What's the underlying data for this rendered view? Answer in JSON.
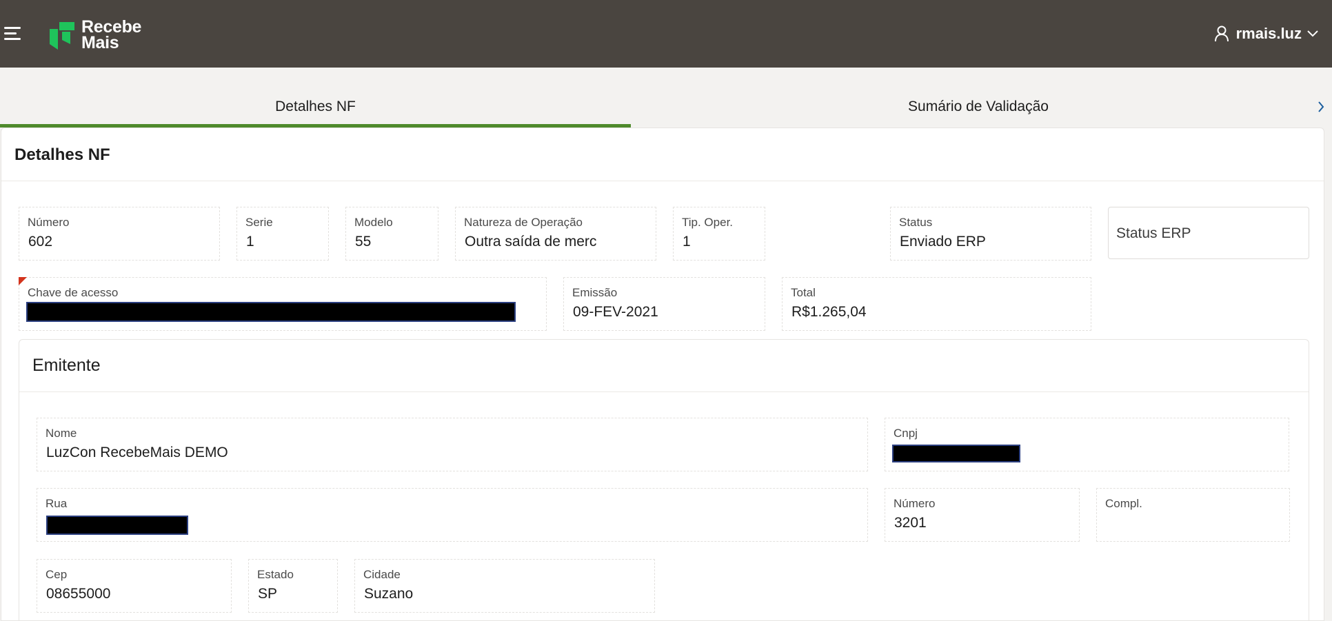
{
  "header": {
    "logo_line1": "Recebe",
    "logo_line2": "Mais",
    "brand_color": "#1fc35b",
    "username": "rmais.luz"
  },
  "tabs": [
    {
      "label": "Detalhes NF",
      "active": true
    },
    {
      "label": "Sumário de Validação",
      "active": false
    }
  ],
  "nf": {
    "title": "Detalhes NF",
    "numero": {
      "label": "Número",
      "value": "602"
    },
    "serie": {
      "label": "Serie",
      "value": "1"
    },
    "modelo": {
      "label": "Modelo",
      "value": "55"
    },
    "natureza": {
      "label": "Natureza de Operação",
      "value": "Outra saída de merc"
    },
    "tip_oper": {
      "label": "Tip. Oper.",
      "value": "1"
    },
    "status": {
      "label": "Status",
      "value": "Enviado ERP"
    },
    "status_erp": {
      "label": "Status ERP"
    },
    "chave": {
      "label": "Chave de acesso"
    },
    "emissao": {
      "label": "Emissão",
      "value": "09-FEV-2021"
    },
    "total": {
      "label": "Total",
      "value": "R$1.265,04"
    }
  },
  "emitente": {
    "title": "Emitente",
    "nome": {
      "label": "Nome",
      "value": "LuzCon RecebeMais DEMO"
    },
    "cnpj": {
      "label": "Cnpj"
    },
    "rua": {
      "label": "Rua"
    },
    "numero": {
      "label": "Número",
      "value": "3201"
    },
    "compl": {
      "label": "Compl."
    },
    "cep": {
      "label": "Cep",
      "value": "08655000"
    },
    "estado": {
      "label": "Estado",
      "value": "SP"
    },
    "cidade": {
      "label": "Cidade",
      "value": "Suzano"
    }
  }
}
